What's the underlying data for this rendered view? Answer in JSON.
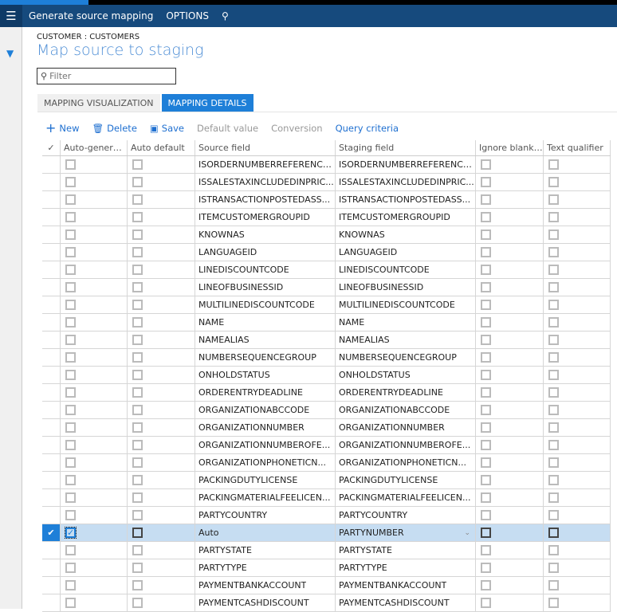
{
  "header": {
    "title": "Generate source mapping",
    "options": "OPTIONS"
  },
  "breadcrumb": "CUSTOMER : CUSTOMERS",
  "page_title": "Map source to staging",
  "filter": {
    "placeholder": "Filter",
    "value": ""
  },
  "tabs": [
    {
      "label": "MAPPING VISUALIZATION",
      "active": false
    },
    {
      "label": "MAPPING DETAILS",
      "active": true
    }
  ],
  "toolbar": {
    "new": "New",
    "delete": "Delete",
    "save": "Save",
    "default_value": "Default value",
    "conversion": "Conversion",
    "query_criteria": "Query criteria"
  },
  "columns": [
    "Auto-generat...",
    "Auto default",
    "Source field",
    "Staging field",
    "Ignore blank ...",
    "Text qualifier"
  ],
  "rows": [
    {
      "source": "ISORDERNUMBERREFERENCE...",
      "staging": "ISORDERNUMBERREFERENCE..."
    },
    {
      "source": "ISSALESTAXINCLUDEDINPRIC...",
      "staging": "ISSALESTAXINCLUDEDINPRIC..."
    },
    {
      "source": "ISTRANSACTIONPOSTEDASS...",
      "staging": "ISTRANSACTIONPOSTEDASS..."
    },
    {
      "source": "ITEMCUSTOMERGROUPID",
      "staging": "ITEMCUSTOMERGROUPID"
    },
    {
      "source": "KNOWNAS",
      "staging": "KNOWNAS"
    },
    {
      "source": "LANGUAGEID",
      "staging": "LANGUAGEID"
    },
    {
      "source": "LINEDISCOUNTCODE",
      "staging": "LINEDISCOUNTCODE"
    },
    {
      "source": "LINEOFBUSINESSID",
      "staging": "LINEOFBUSINESSID"
    },
    {
      "source": "MULTILINEDISCOUNTCODE",
      "staging": "MULTILINEDISCOUNTCODE"
    },
    {
      "source": "NAME",
      "staging": "NAME"
    },
    {
      "source": "NAMEALIAS",
      "staging": "NAMEALIAS"
    },
    {
      "source": "NUMBERSEQUENCEGROUP",
      "staging": "NUMBERSEQUENCEGROUP"
    },
    {
      "source": "ONHOLDSTATUS",
      "staging": "ONHOLDSTATUS"
    },
    {
      "source": "ORDERENTRYDEADLINE",
      "staging": "ORDERENTRYDEADLINE"
    },
    {
      "source": "ORGANIZATIONABCCODE",
      "staging": "ORGANIZATIONABCCODE"
    },
    {
      "source": "ORGANIZATIONNUMBER",
      "staging": "ORGANIZATIONNUMBER"
    },
    {
      "source": "ORGANIZATIONNUMBEROFE...",
      "staging": "ORGANIZATIONNUMBEROFE..."
    },
    {
      "source": "ORGANIZATIONPHONETICN...",
      "staging": "ORGANIZATIONPHONETICN..."
    },
    {
      "source": "PACKINGDUTYLICENSE",
      "staging": "PACKINGDUTYLICENSE"
    },
    {
      "source": "PACKINGMATERIALFEELICEN...",
      "staging": "PACKINGMATERIALFEELICEN..."
    },
    {
      "source": "PARTYCOUNTRY",
      "staging": "PARTYCOUNTRY"
    },
    {
      "source": "Auto",
      "staging": "PARTYNUMBER",
      "selected": true,
      "auto_generated": true
    },
    {
      "source": "PARTYSTATE",
      "staging": "PARTYSTATE"
    },
    {
      "source": "PARTYTYPE",
      "staging": "PARTYTYPE"
    },
    {
      "source": "PAYMENTBANKACCOUNT",
      "staging": "PAYMENTBANKACCOUNT"
    },
    {
      "source": "PAYMENTCASHDISCOUNT",
      "staging": "PAYMENTCASHDISCOUNT"
    }
  ],
  "colors": {
    "header": "#164a7d",
    "accent": "#1e7fd8",
    "selected_row": "#c6ddf2"
  }
}
